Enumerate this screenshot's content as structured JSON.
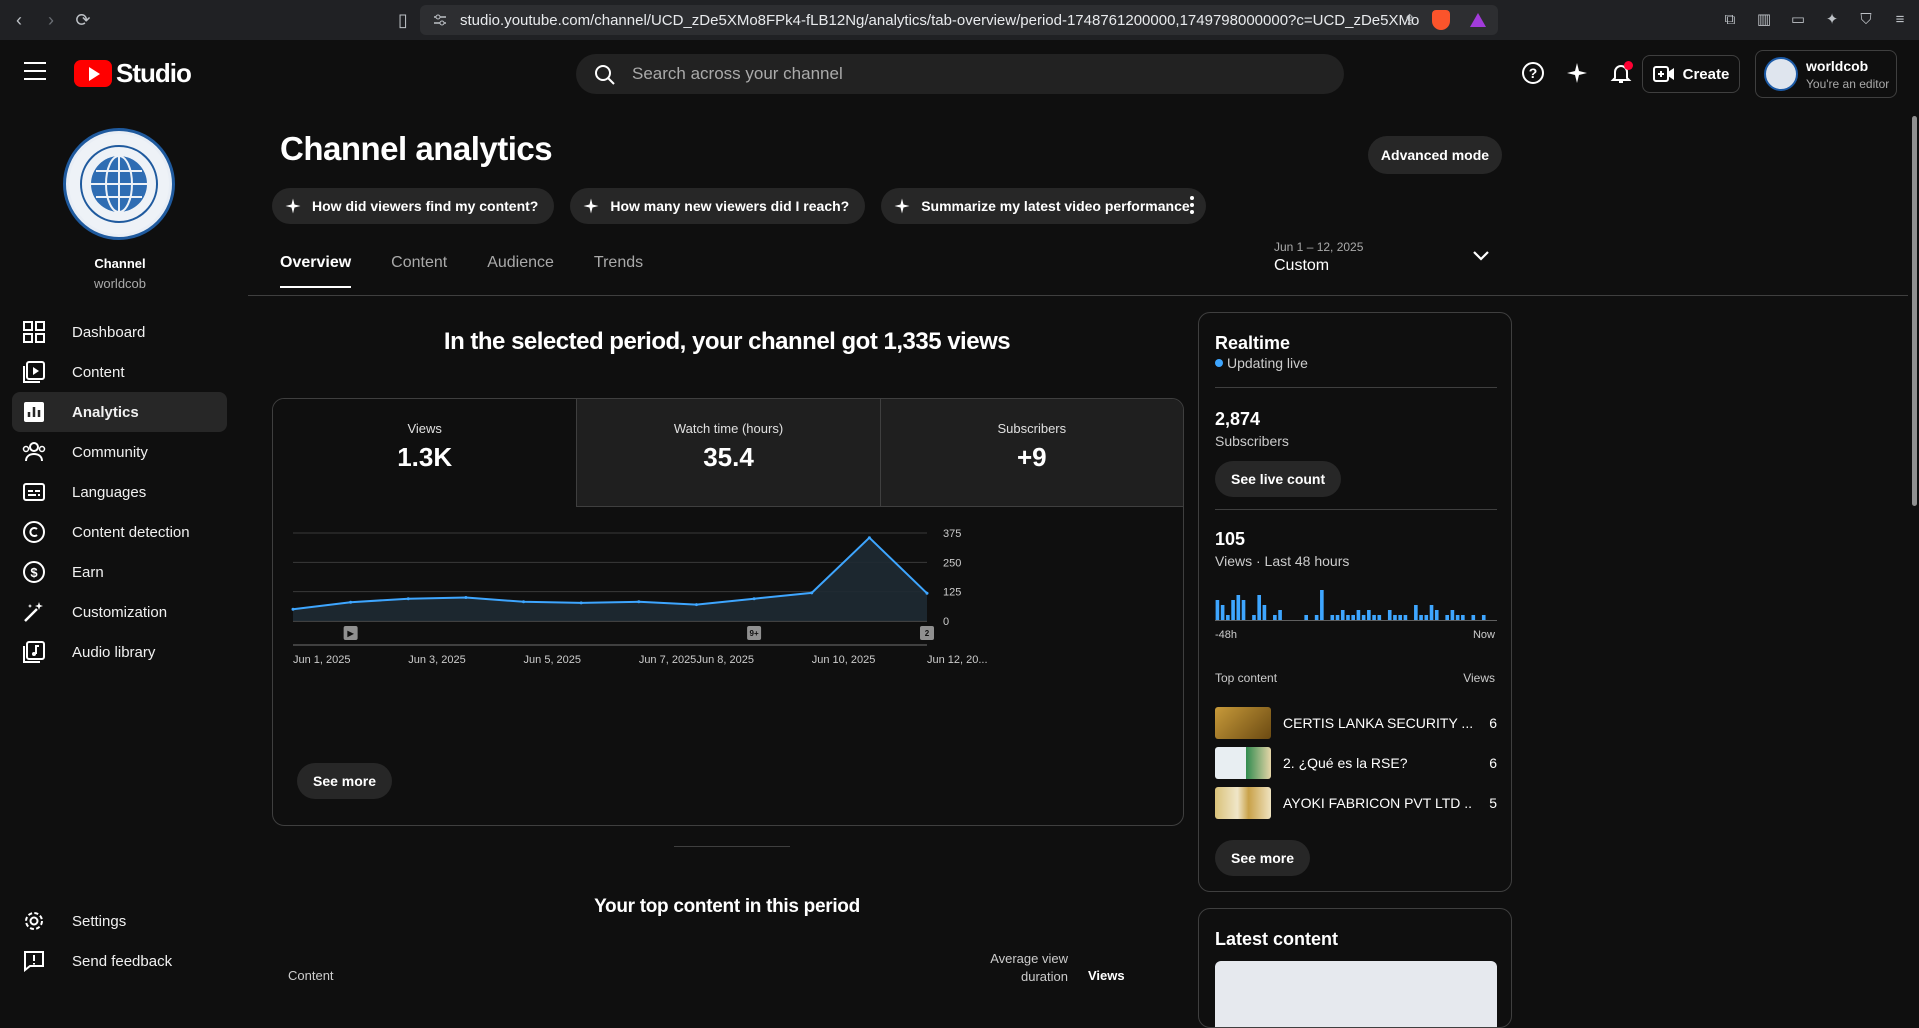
{
  "browser": {
    "url": "studio.youtube.com/channel/UCD_zDe5XMo8FPk4-fLB12Ng/analytics/tab-overview/period-1748761200000,1749798000000?c=UCD_zDe5XMo8FPk4..."
  },
  "header": {
    "logo_text": "Studio",
    "search_placeholder": "Search across your channel",
    "create_label": "Create",
    "account_name": "worldcob",
    "account_role": "You're an editor"
  },
  "sidebar": {
    "channel_title": "Channel",
    "channel_handle": "worldcob",
    "items": [
      {
        "label": "Dashboard",
        "icon": "dashboard-icon"
      },
      {
        "label": "Content",
        "icon": "content-icon"
      },
      {
        "label": "Analytics",
        "icon": "analytics-icon",
        "active": true
      },
      {
        "label": "Community",
        "icon": "community-icon"
      },
      {
        "label": "Languages",
        "icon": "subtitles-icon"
      },
      {
        "label": "Content detection",
        "icon": "copyright-icon"
      },
      {
        "label": "Earn",
        "icon": "dollar-icon"
      },
      {
        "label": "Customization",
        "icon": "magic-wand-icon"
      },
      {
        "label": "Audio library",
        "icon": "audio-library-icon"
      }
    ],
    "bottom": [
      {
        "label": "Settings",
        "icon": "gear-icon"
      },
      {
        "label": "Send feedback",
        "icon": "feedback-icon"
      }
    ]
  },
  "page": {
    "title": "Channel analytics",
    "advanced_mode": "Advanced mode",
    "chips": [
      "How did viewers find my content?",
      "How many new viewers did I reach?",
      "Summarize my latest video performance"
    ],
    "tabs": [
      "Overview",
      "Content",
      "Audience",
      "Trends"
    ],
    "date_range": "Jun 1 – 12, 2025",
    "date_mode": "Custom",
    "headline": "In the selected period, your channel got 1,335 views",
    "metrics": [
      {
        "label": "Views",
        "value": "1.3K"
      },
      {
        "label": "Watch time (hours)",
        "value": "35.4"
      },
      {
        "label": "Subscribers",
        "value": "+9"
      }
    ],
    "see_more": "See more",
    "markers": {
      "video": "▶",
      "group": "9+",
      "count": "2"
    },
    "top_content_title": "Your top content in this period",
    "table": {
      "col_content": "Content",
      "col_avg": "Average view duration",
      "col_views": "Views"
    }
  },
  "chart_data": {
    "type": "line",
    "x": [
      "Jun 1, 2025",
      "Jun 2, 2025",
      "Jun 3, 2025",
      "Jun 4, 2025",
      "Jun 5, 2025",
      "Jun 6, 2025",
      "Jun 7, 2025",
      "Jun 8, 2025",
      "Jun 9, 2025",
      "Jun 10, 2025",
      "Jun 11, 2025",
      "Jun 12, 2025"
    ],
    "x_tick_labels": [
      "Jun 1, 2025",
      "Jun 3, 2025",
      "Jun 5, 2025",
      "Jun 7, 2025",
      "Jun 8, 2025",
      "Jun 10, 2025",
      "Jun 12, 20..."
    ],
    "values": [
      50,
      80,
      95,
      100,
      82,
      77,
      82,
      70,
      95,
      120,
      355,
      118
    ],
    "yticks": [
      0,
      125,
      250,
      375
    ],
    "ylim": [
      0,
      375
    ],
    "color": "#3ea6ff"
  },
  "realtime": {
    "title": "Realtime",
    "status": "Updating live",
    "subscribers": "2,874",
    "subscribers_label": "Subscribers",
    "see_live_count": "See live count",
    "views": "105",
    "views_label": "Views · Last 48 hours",
    "axis_left": "-48h",
    "axis_right": "Now",
    "bars": [
      4,
      3,
      1,
      4,
      5,
      4,
      0,
      1,
      5,
      3,
      0,
      1,
      2,
      0,
      0,
      0,
      0,
      1,
      0,
      1,
      6,
      0,
      1,
      1,
      2,
      1,
      1,
      2,
      1,
      2,
      1,
      1,
      0,
      2,
      1,
      1,
      1,
      0,
      3,
      1,
      1,
      3,
      2,
      0,
      1,
      2,
      1,
      1,
      0,
      1,
      0,
      1,
      0,
      0
    ],
    "top_content_label": "Top content",
    "views_col": "Views",
    "top_content": [
      {
        "title": "CERTIS LANKA SECURITY ...",
        "views": "6"
      },
      {
        "title": "2. ¿Qué es la RSE?",
        "views": "6"
      },
      {
        "title": "AYOKI FABRICON PVT LTD ...",
        "views": "5"
      }
    ],
    "see_more": "See more"
  },
  "latest": {
    "title": "Latest content"
  }
}
